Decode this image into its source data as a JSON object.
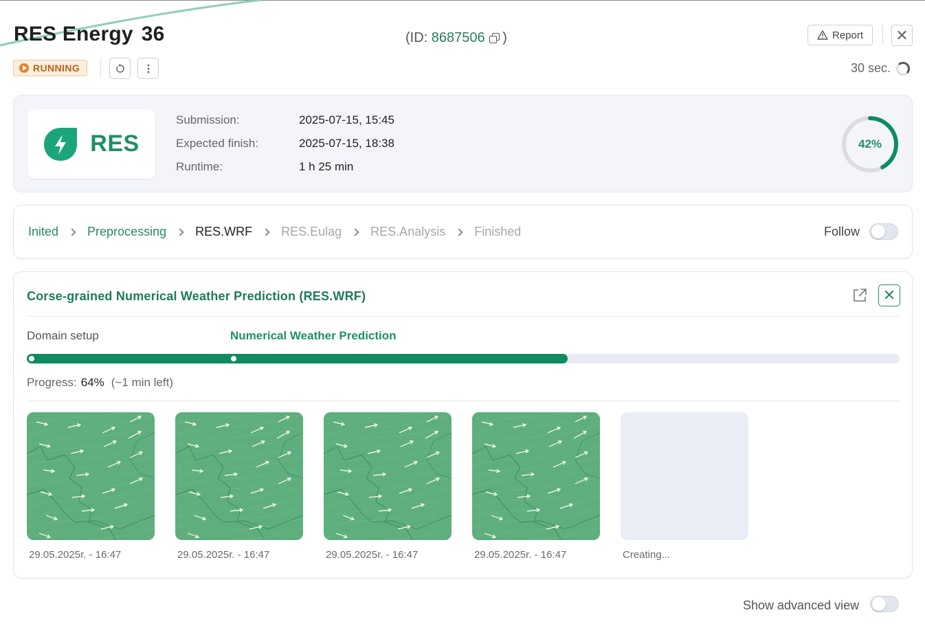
{
  "header": {
    "title": "RES Energy",
    "run_number": "36",
    "id_prefix": "(ID: ",
    "id_value": "8687506",
    "id_suffix": ")",
    "report_label": "Report",
    "status": "RUNNING",
    "refresh_interval": "30 sec."
  },
  "summary": {
    "logo_text": "RES",
    "submission_label": "Submission:",
    "submission_value": "2025-07-15, 15:45",
    "expected_label": "Expected finish:",
    "expected_value": "2025-07-15, 18:38",
    "runtime_label": "Runtime:",
    "runtime_value": "1 h 25 min",
    "overall_progress": 42,
    "overall_progress_label": "42%"
  },
  "stepper": {
    "steps": [
      {
        "label": "Inited",
        "state": "done"
      },
      {
        "label": "Preprocessing",
        "state": "done"
      },
      {
        "label": "RES.WRF",
        "state": "current"
      },
      {
        "label": "RES.Eulag",
        "state": "future"
      },
      {
        "label": "RES.Analysis",
        "state": "future"
      },
      {
        "label": "Finished",
        "state": "future"
      }
    ],
    "follow_label": "Follow",
    "follow_on": false
  },
  "detail": {
    "title": "Corse-grained Numerical Weather Prediction (RES.WRF)",
    "phase_a": "Domain setup",
    "phase_b": "Numerical Weather Prediction",
    "progress_fraction": 0.62,
    "progress_label": "Progress:",
    "progress_value": "64%",
    "progress_eta": "(~1 min left)",
    "thumbnails": [
      {
        "caption": "29.05.2025r. - 16:47",
        "ready": true
      },
      {
        "caption": "29.05.2025r. - 16:47",
        "ready": true
      },
      {
        "caption": "29.05.2025r. - 16:47",
        "ready": true
      },
      {
        "caption": "29.05.2025r. - 16:47",
        "ready": true
      },
      {
        "caption": "Creating...",
        "ready": false
      }
    ]
  },
  "footer": {
    "advanced_label": "Show advanced view",
    "advanced_on": false
  },
  "colors": {
    "accent": "#1e8f6a",
    "progress": "#0f8b63",
    "status_bg": "#fbeede",
    "status_text": "#b7641a",
    "map_green": "#5fae7d"
  }
}
